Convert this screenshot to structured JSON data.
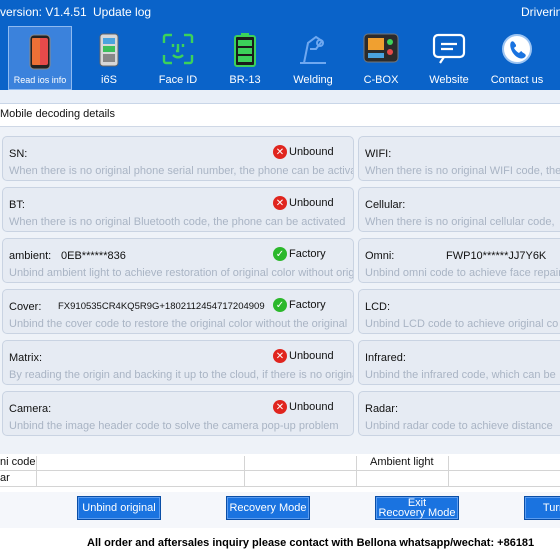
{
  "titlebar": {
    "version": "version: V1.4.51",
    "update": "Update log",
    "driver": "Driverin"
  },
  "toolbar": [
    {
      "label": "Read ios info",
      "icon": "iphone-icon"
    },
    {
      "label": "i6S",
      "icon": "phone-board-icon"
    },
    {
      "label": "Face ID",
      "icon": "face-id-icon"
    },
    {
      "label": "BR-13",
      "icon": "battery-icon"
    },
    {
      "label": "Welding",
      "icon": "welding-icon"
    },
    {
      "label": "C-BOX",
      "icon": "cbox-icon"
    },
    {
      "label": "Website",
      "icon": "website-icon"
    },
    {
      "label": "Contact us",
      "icon": "phone-call-icon"
    }
  ],
  "section_title": "Mobile decoding details",
  "left_cards": [
    {
      "name": "SN:",
      "value": "",
      "status": "Unbound",
      "ok": false,
      "hint": "When there is no original phone serial number, the phone can be activated"
    },
    {
      "name": "BT:",
      "value": "",
      "status": "Unbound",
      "ok": false,
      "hint": "When there is no original Bluetooth code, the phone can be activated"
    },
    {
      "name": "ambient:",
      "value": "0EB******836",
      "status": "Factory",
      "ok": true,
      "hint": "Unbind ambient light to achieve restoration of original color without original"
    },
    {
      "name": "Cover:",
      "value": "FX910535CR4KQ5R9G+1802112454717204909",
      "status": "Factory",
      "ok": true,
      "hint": "Unbind the cover code to restore the original color without the original"
    },
    {
      "name": "Matrix:",
      "value": "",
      "status": "Unbound",
      "ok": false,
      "hint": "By reading the origin and backing it up to the cloud, if there is no original"
    },
    {
      "name": "Camera:",
      "value": "",
      "status": "Unbound",
      "ok": false,
      "hint": "Unbind the image header code to solve the camera pop-up problem"
    }
  ],
  "right_cards": [
    {
      "name": "WIFI:",
      "value": "",
      "hint": "When there is no original WIFI code, the"
    },
    {
      "name": "Cellular:",
      "value": "",
      "hint": "When there is no original cellular code,"
    },
    {
      "name": "Omni:",
      "value": "FWP10******JJ7Y6K",
      "hint": "Unbind omni code to achieve face repair"
    },
    {
      "name": "LCD:",
      "value": "",
      "hint": "Unbind LCD code to achieve original co"
    },
    {
      "name": "Infrared:",
      "value": "",
      "hint": "Unbind the infrared code, which can be"
    },
    {
      "name": "Radar:",
      "value": "",
      "hint": "Unbind radar code to achieve distance"
    }
  ],
  "table": {
    "row1_left": "ni code",
    "row1_right": "Ambient light",
    "row2_left": "ar"
  },
  "buttons": [
    {
      "label": "Unbind original"
    },
    {
      "label": "Recovery Mode"
    },
    {
      "label": "Exit\nRecovery Mode"
    },
    {
      "label": "Turn"
    }
  ],
  "footer": "All order and aftersales inquiry please contact with Bellona whatsapp/wechat: +86181"
}
